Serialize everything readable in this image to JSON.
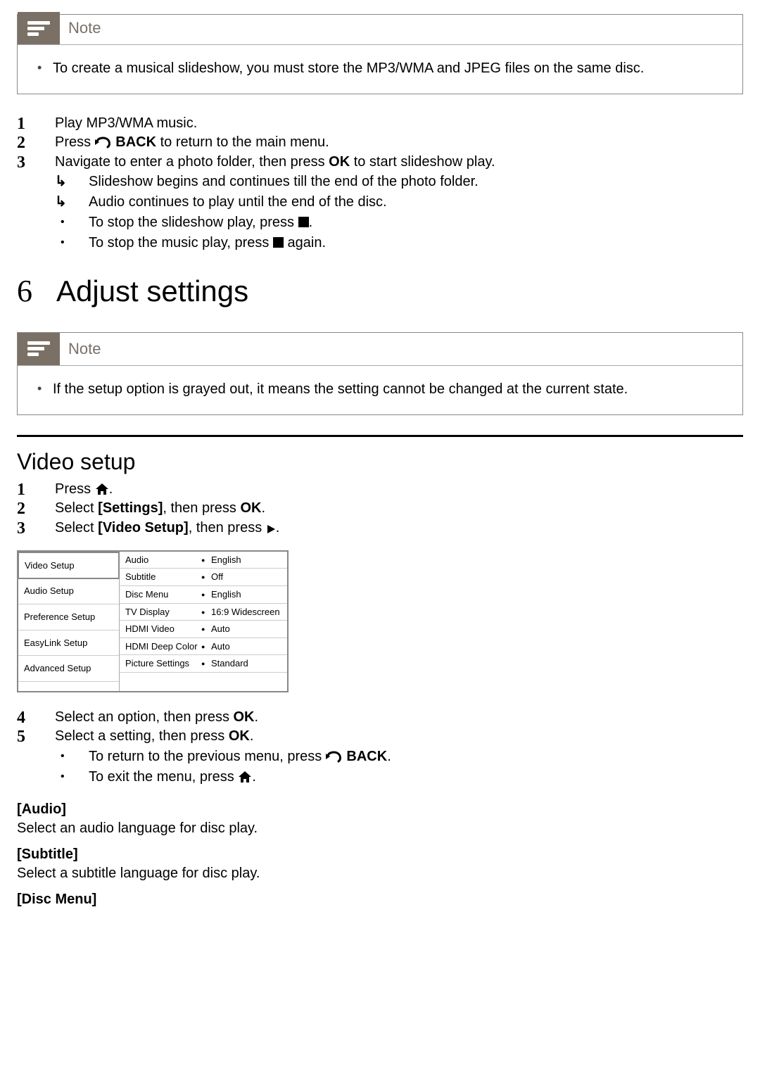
{
  "note1": {
    "title": "Note",
    "body": "To create a musical slideshow, you must store the MP3/WMA and JPEG files on the same disc."
  },
  "steps1": {
    "s1": "Play MP3/WMA music.",
    "s2_pre": "Press ",
    "s2_back": "BACK",
    "s2_post": " to return to the main menu.",
    "s3_pre": "Navigate to enter a photo folder, then press ",
    "s3_ok": "OK",
    "s3_post": " to start slideshow play.",
    "sub1": "Slideshow begins and continues till the end of the photo folder.",
    "sub2": "Audio continues to play until the end of the disc.",
    "sub3_pre": "To stop the slideshow play, press ",
    "sub3_post": ".",
    "sub4_pre": "To stop the music play, press ",
    "sub4_post": " again."
  },
  "section6": {
    "num": "6",
    "title": "Adjust settings"
  },
  "note2": {
    "title": "Note",
    "body": "If the setup option is grayed out, it means the setting cannot be changed at the current state."
  },
  "video_setup_heading": "Video setup",
  "vs_steps": {
    "s1_pre": "Press ",
    "s1_post": ".",
    "s2_pre": "Select ",
    "s2_settings": "[Settings]",
    "s2_mid": ", then press ",
    "s2_ok": "OK",
    "s2_post": ".",
    "s3_pre": "Select ",
    "s3_video": "[Video Setup]",
    "s3_mid": ", then press ",
    "s3_post": "."
  },
  "menu": {
    "left": [
      "Video Setup",
      "Audio Setup",
      "Preference Setup",
      "EasyLink Setup",
      "Advanced Setup"
    ],
    "rows": [
      {
        "label": "Audio",
        "val": "English"
      },
      {
        "label": "Subtitle",
        "val": "Off"
      },
      {
        "label": "Disc Menu",
        "val": "English"
      },
      {
        "label": "TV Display",
        "val": "16:9 Widescreen"
      },
      {
        "label": "HDMI Video",
        "val": "Auto"
      },
      {
        "label": "HDMI Deep Color",
        "val": "Auto"
      },
      {
        "label": "Picture Settings",
        "val": "Standard"
      }
    ]
  },
  "vs_steps2": {
    "s4_pre": "Select an option, then press ",
    "s4_ok": "OK",
    "s4_post": ".",
    "s5_pre": "Select a setting, then press ",
    "s5_ok": "OK",
    "s5_post": ".",
    "sub1_pre": "To return to the previous menu, press ",
    "sub1_back": "BACK",
    "sub1_post": ".",
    "sub2_pre": "To exit the menu, press ",
    "sub2_post": "."
  },
  "defs": {
    "audio_t": "[Audio]",
    "audio_b": "Select an audio language for disc play.",
    "subtitle_t": "[Subtitle]",
    "subtitle_b": "Select a subtitle language for disc play.",
    "disc_t": "[Disc Menu]"
  }
}
